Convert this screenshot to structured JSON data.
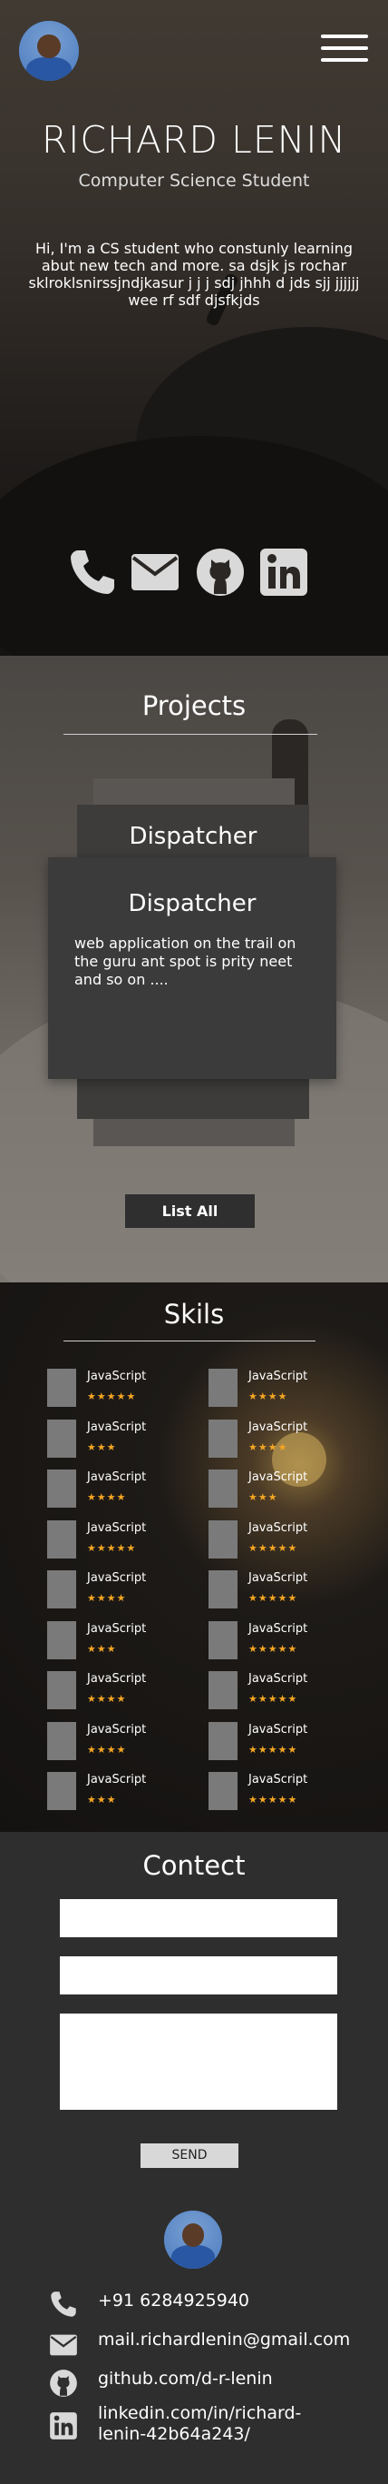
{
  "hero": {
    "name": "RICHARD LENIN",
    "subtitle": "Computer Science Student",
    "bio": "Hi, I'm a CS student who constunly learning abut new tech and more.  sa dsjk js  rochar sklroklsnirssjndjkasur   j j j sdj jhhh d jds sjj     jjjjjj     wee rf    sdf djsfkjds",
    "menu_icon": "hamburger-menu-icon",
    "social_icons": [
      "phone-icon",
      "mail-icon",
      "github-icon",
      "linkedin-icon"
    ]
  },
  "projects": {
    "title": "Projects",
    "back_card_title": "Dispatcher",
    "card_title": "Dispatcher",
    "card_description": "web application on the trail on the guru ant spot is prity neet and so on ....",
    "list_all_label": "List All"
  },
  "skills": {
    "title": "Skils",
    "left": [
      {
        "name": "JavaScript",
        "stars": "★★★★★"
      },
      {
        "name": "JavaScript",
        "stars": "★★★"
      },
      {
        "name": "JavaScript",
        "stars": "★★★★"
      },
      {
        "name": "JavaScript",
        "stars": "★★★★★"
      },
      {
        "name": "JavaScript",
        "stars": "★★★★"
      },
      {
        "name": "JavaScript",
        "stars": "★★★"
      },
      {
        "name": "JavaScript",
        "stars": "★★★★"
      },
      {
        "name": "JavaScript",
        "stars": "★★★★"
      },
      {
        "name": "JavaScript",
        "stars": "★★★"
      }
    ],
    "right": [
      {
        "name": "JavaScript",
        "stars": "★★★★"
      },
      {
        "name": "JavaScript",
        "stars": "★★★★"
      },
      {
        "name": "JavaScript",
        "stars": "★★★"
      },
      {
        "name": "JavaScript",
        "stars": "★★★★★"
      },
      {
        "name": "JavaScript",
        "stars": "★★★★★"
      },
      {
        "name": "JavaScript",
        "stars": "★★★★★"
      },
      {
        "name": "JavaScript",
        "stars": "★★★★★"
      },
      {
        "name": "JavaScript",
        "stars": "★★★★★"
      },
      {
        "name": "JavaScript",
        "stars": "★★★★★"
      }
    ],
    "star_color": "#f5a623"
  },
  "contact": {
    "title": "Contect",
    "send_label": "SEND",
    "phone": "+91 6284925940",
    "email": "mail.richardlenin@gmail.com",
    "github": "github.com/d-r-lenin",
    "linkedin": "linkedin.com/in/richard-lenin-42b64a243/"
  }
}
